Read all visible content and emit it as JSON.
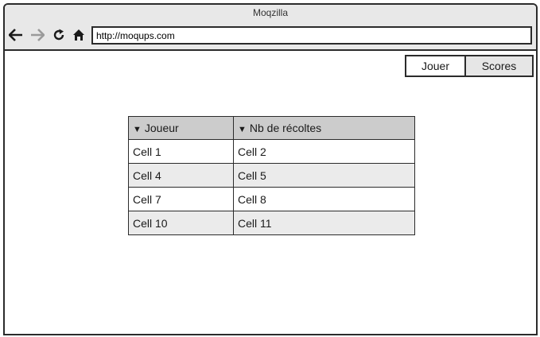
{
  "window": {
    "title": "Moqzilla"
  },
  "toolbar": {
    "back_icon": "arrow-left-icon",
    "forward_icon": "arrow-right-icon",
    "reload_icon": "reload-icon",
    "home_icon": "home-icon",
    "url": "http://moqups.com"
  },
  "tabs": [
    {
      "label": "Jouer"
    },
    {
      "label": "Scores"
    }
  ],
  "table": {
    "sort_glyph": "▼",
    "columns": [
      "Joueur",
      "Nb de récoltes"
    ],
    "rows": [
      [
        "Cell 1",
        "Cell 2"
      ],
      [
        "Cell 4",
        "Cell 5"
      ],
      [
        "Cell 7",
        "Cell 8"
      ],
      [
        "Cell 10",
        "Cell 11"
      ]
    ]
  },
  "colors": {
    "border": "#2b2b2b",
    "chrome": "#e8e8e8",
    "header": "#cccccc",
    "alt_row": "#ebebeb"
  }
}
